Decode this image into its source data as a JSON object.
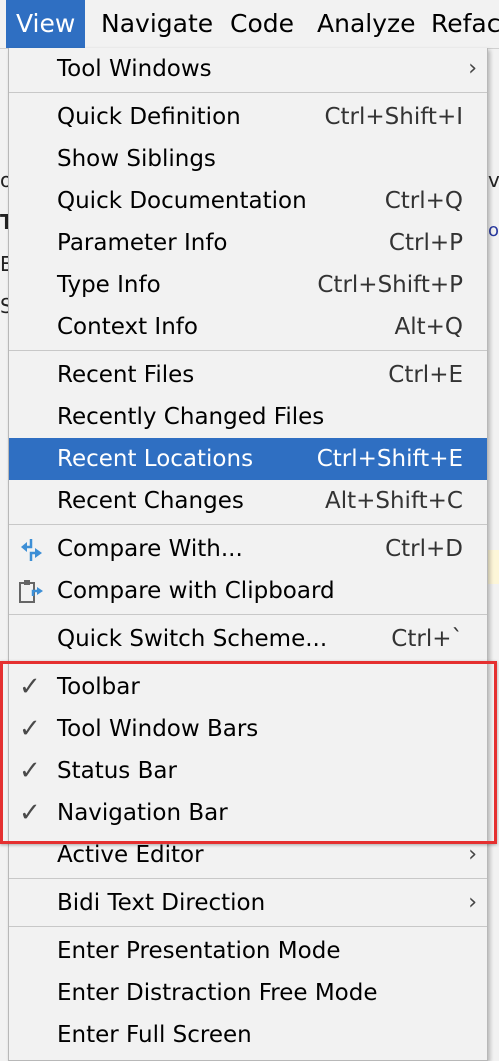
{
  "menubar": {
    "items": [
      {
        "label": "View",
        "active": true
      },
      {
        "label": "Navigate"
      },
      {
        "label": "Code"
      },
      {
        "label": "Analyze"
      },
      {
        "label": "Refact"
      }
    ]
  },
  "background": {
    "frag_v": "v",
    "frag_ou": "ou",
    "frag_t": "T",
    "frag_e": "E",
    "frag_s": "S",
    "frag_o": "o"
  },
  "menu": {
    "items": [
      {
        "label": "Tool Windows",
        "submenu": true
      },
      {
        "label": "Quick Definition",
        "shortcut": "Ctrl+Shift+I"
      },
      {
        "label": "Show Siblings"
      },
      {
        "label": "Quick Documentation",
        "shortcut": "Ctrl+Q"
      },
      {
        "label": "Parameter Info",
        "shortcut": "Ctrl+P"
      },
      {
        "label": "Type Info",
        "shortcut": "Ctrl+Shift+P"
      },
      {
        "label": "Context Info",
        "shortcut": "Alt+Q"
      },
      {
        "label": "Recent Files",
        "shortcut": "Ctrl+E"
      },
      {
        "label": "Recently Changed Files"
      },
      {
        "label": "Recent Locations",
        "shortcut": "Ctrl+Shift+E",
        "selected": true
      },
      {
        "label": "Recent Changes",
        "shortcut": "Alt+Shift+C"
      },
      {
        "label": "Compare With...",
        "shortcut": "Ctrl+D",
        "icon": "compare-icon"
      },
      {
        "label": "Compare with Clipboard",
        "icon": "compare-clipboard-icon"
      },
      {
        "label": "Quick Switch Scheme...",
        "shortcut": "Ctrl+`"
      },
      {
        "label": "Toolbar",
        "checked": true
      },
      {
        "label": "Tool Window Bars",
        "checked": true
      },
      {
        "label": "Status Bar",
        "checked": true
      },
      {
        "label": "Navigation Bar",
        "checked": true
      },
      {
        "label": "Active Editor",
        "submenu": true
      },
      {
        "label": "Bidi Text Direction",
        "submenu": true
      },
      {
        "label": "Enter Presentation Mode"
      },
      {
        "label": "Enter Distraction Free Mode"
      },
      {
        "label": "Enter Full Screen"
      }
    ],
    "check_glyph": "✓",
    "submenu_glyph": "›"
  },
  "colors": {
    "selection": "#2f6fc2",
    "highlight_box": "#e53030"
  }
}
